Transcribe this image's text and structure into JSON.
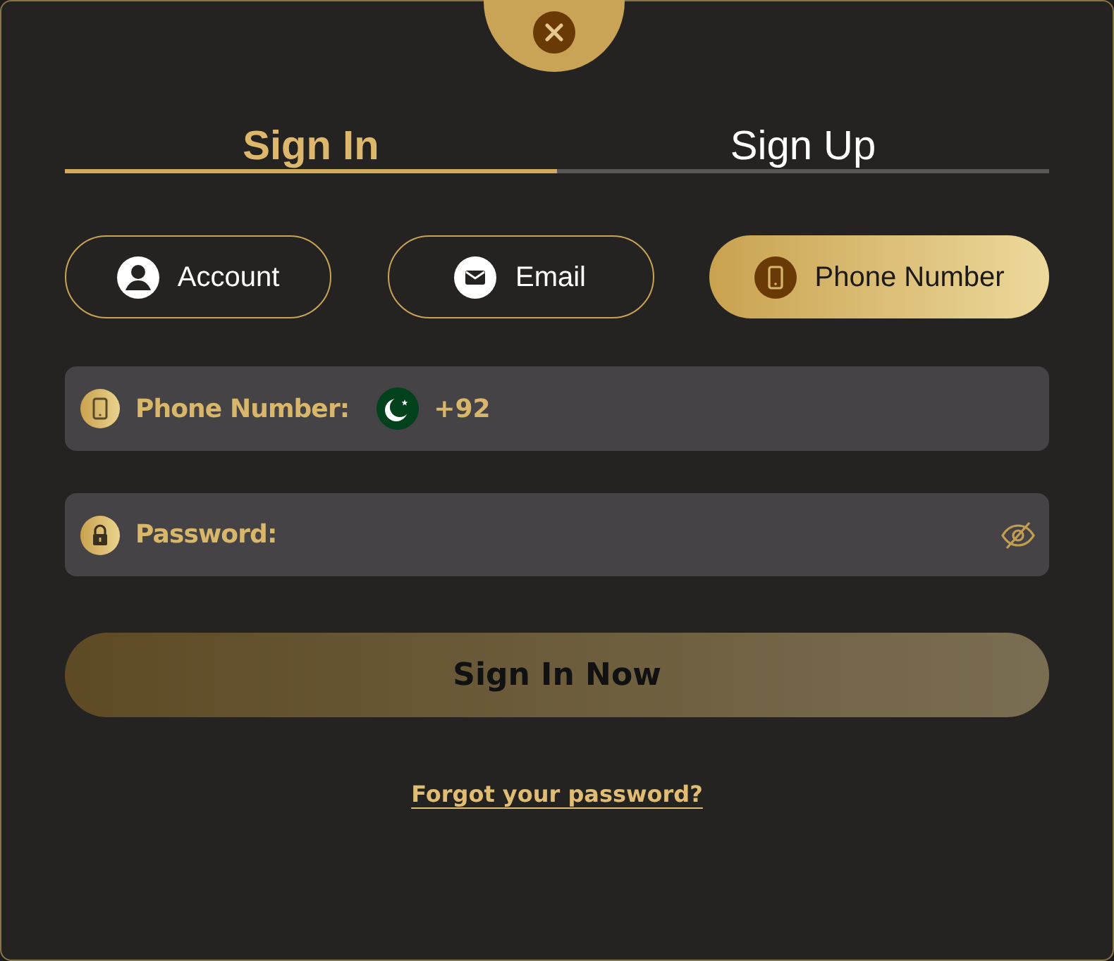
{
  "tabs": [
    {
      "label": "Sign In",
      "selected": true
    },
    {
      "label": "Sign Up",
      "selected": false
    }
  ],
  "methods": [
    {
      "kind": "account",
      "label": "Account",
      "selected": false
    },
    {
      "kind": "email",
      "label": "Email",
      "selected": false
    },
    {
      "kind": "phone",
      "label": "Phone Number",
      "selected": true
    }
  ],
  "fields": [
    {
      "kind": "phone",
      "label": "Phone Number:",
      "country_code": "+92"
    },
    {
      "kind": "password",
      "label": "Password:",
      "visible": false
    }
  ],
  "submit": "Sign In Now",
  "forgot_link": "Forgot your password?"
}
